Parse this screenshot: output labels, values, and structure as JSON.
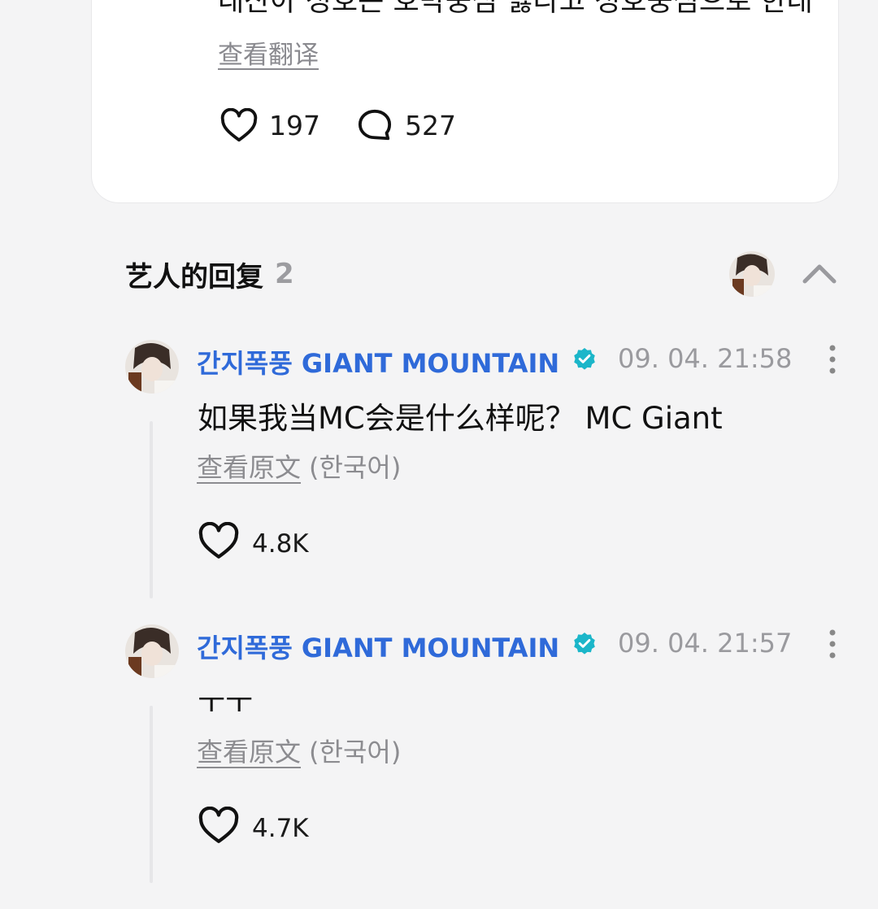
{
  "post": {
    "text": "태산아 성호는 호박중심 싫다고 성호중심으로 한대",
    "translate_label": "查看翻译",
    "likes": "197",
    "comments": "527"
  },
  "artist_replies": {
    "title": "艺人的回复",
    "count": "2"
  },
  "replies": [
    {
      "author": "간지폭풍 GIANT MOUNTAIN",
      "time": "09. 04. 21:58",
      "text": "如果我当MC会是什么样呢？ MC Giant",
      "original_label": "查看原文",
      "original_lang": "(한국어)",
      "likes": "4.8K"
    },
    {
      "author": "간지폭풍 GIANT MOUNTAIN",
      "time": "09. 04. 21:57",
      "text": "ㅜㅜ",
      "original_label": "查看原文",
      "original_lang": "(한국어)",
      "likes": "4.7K"
    }
  ],
  "colors": {
    "author_blue": "#2f6ad9",
    "verified_teal": "#1bb6c9",
    "muted_gray": "#8c8c90"
  },
  "icons": [
    "heart-icon",
    "comment-bubble-icon",
    "verified-badge-icon",
    "more-vertical-icon",
    "chevron-up-icon"
  ]
}
